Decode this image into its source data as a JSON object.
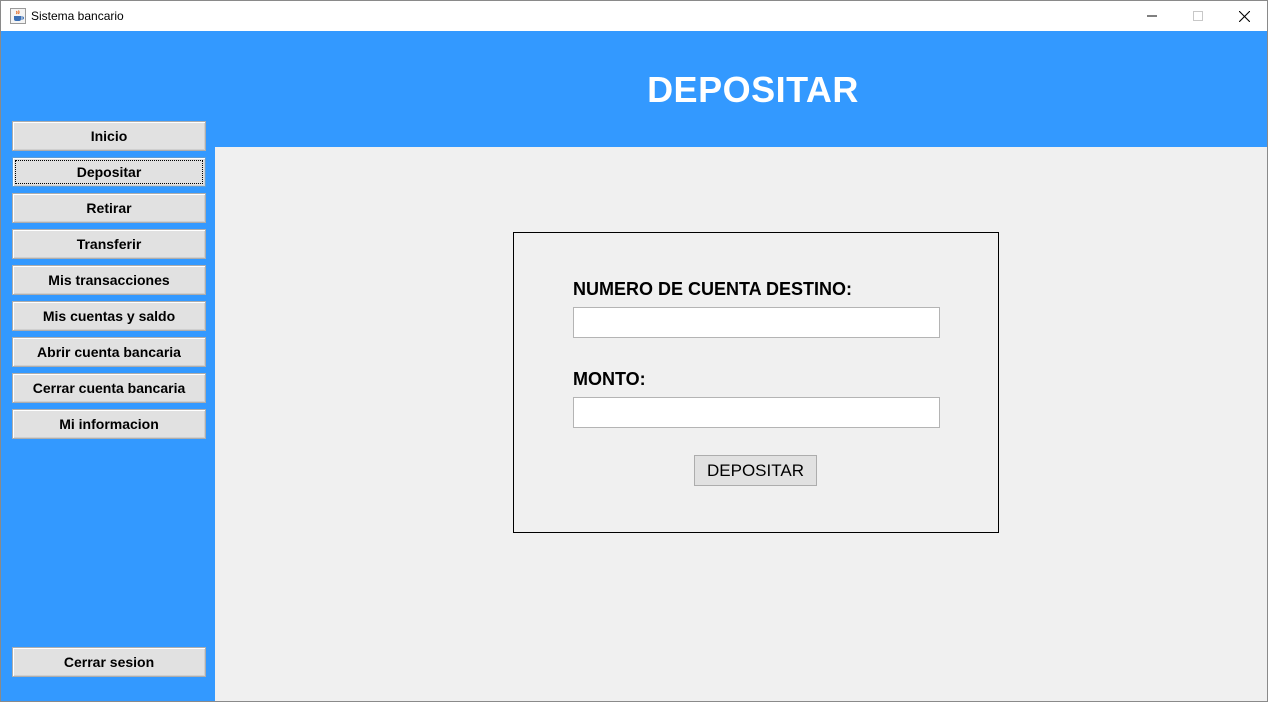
{
  "window": {
    "title": "Sistema bancario",
    "app_icon": "java-cup-icon",
    "controls": {
      "minimize_icon": "minimize-icon",
      "maximize_icon": "maximize-icon",
      "close_icon": "close-icon"
    }
  },
  "header": {
    "title": "DEPOSITAR"
  },
  "sidebar": {
    "items": [
      {
        "label": "Inicio"
      },
      {
        "label": "Depositar"
      },
      {
        "label": "Retirar"
      },
      {
        "label": "Transferir"
      },
      {
        "label": "Mis transacciones"
      },
      {
        "label": "Mis cuentas y saldo"
      },
      {
        "label": "Abrir cuenta bancaria"
      },
      {
        "label": "Cerrar cuenta bancaria"
      },
      {
        "label": "Mi informacion"
      }
    ],
    "focused_item": "Depositar",
    "logout_label": "Cerrar sesion"
  },
  "form": {
    "account_label": "NUMERO DE CUENTA DESTINO:",
    "account_value": "",
    "amount_label": "MONTO:",
    "amount_value": "",
    "submit_label": "DEPOSITAR"
  },
  "colors": {
    "accent": "#3399ff",
    "content_bg": "#f0f0f0",
    "button_bg": "#e1e1e1"
  }
}
